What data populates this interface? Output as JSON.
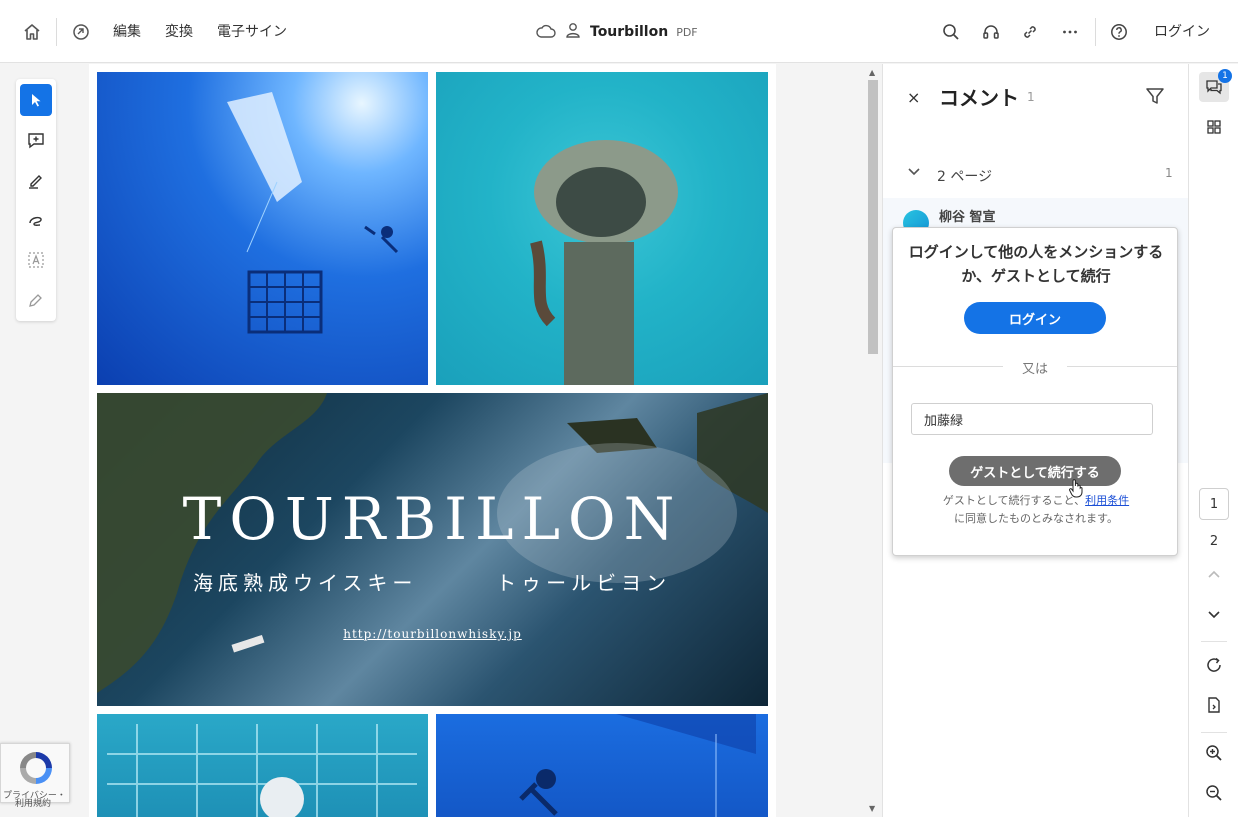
{
  "topbar": {
    "menu": [
      "編集",
      "変換",
      "電子サイン"
    ],
    "doc_name": "Tourbillon",
    "doc_ext": "PDF",
    "login_label": "ログイン"
  },
  "document": {
    "hero_title": "TOURBILLON",
    "hero_subtitle_left": "海底熟成ウイスキー",
    "hero_subtitle_right": "トゥールビヨン",
    "hero_url": "http://tourbillonwhisky.jp"
  },
  "panel": {
    "close": "×",
    "title": "コメント",
    "count": "1",
    "section_label": "2 ページ",
    "section_count": "1",
    "comment_author": "柳谷 智宣"
  },
  "popover": {
    "message": "ログインして他の人をメンションするか、ゲストとして続行",
    "login_button": "ログイン",
    "or_label": "又は",
    "guest_name_value": "加藤緑",
    "guest_button": "ゲストとして続行する",
    "terms_prefix": "ゲストとして続行すること、",
    "terms_link": "利用条件",
    "terms_suffix": "に同意したものとみなされます。"
  },
  "rail": {
    "comment_badge": "1",
    "current_page": "1",
    "total_pages": "2"
  },
  "recaptcha": {
    "privacy": "プライバシー・",
    "terms": "利用規約"
  },
  "colors": {
    "accent": "#1473e6",
    "guest_button": "#6e6e6e",
    "link": "#1a4ed6"
  }
}
